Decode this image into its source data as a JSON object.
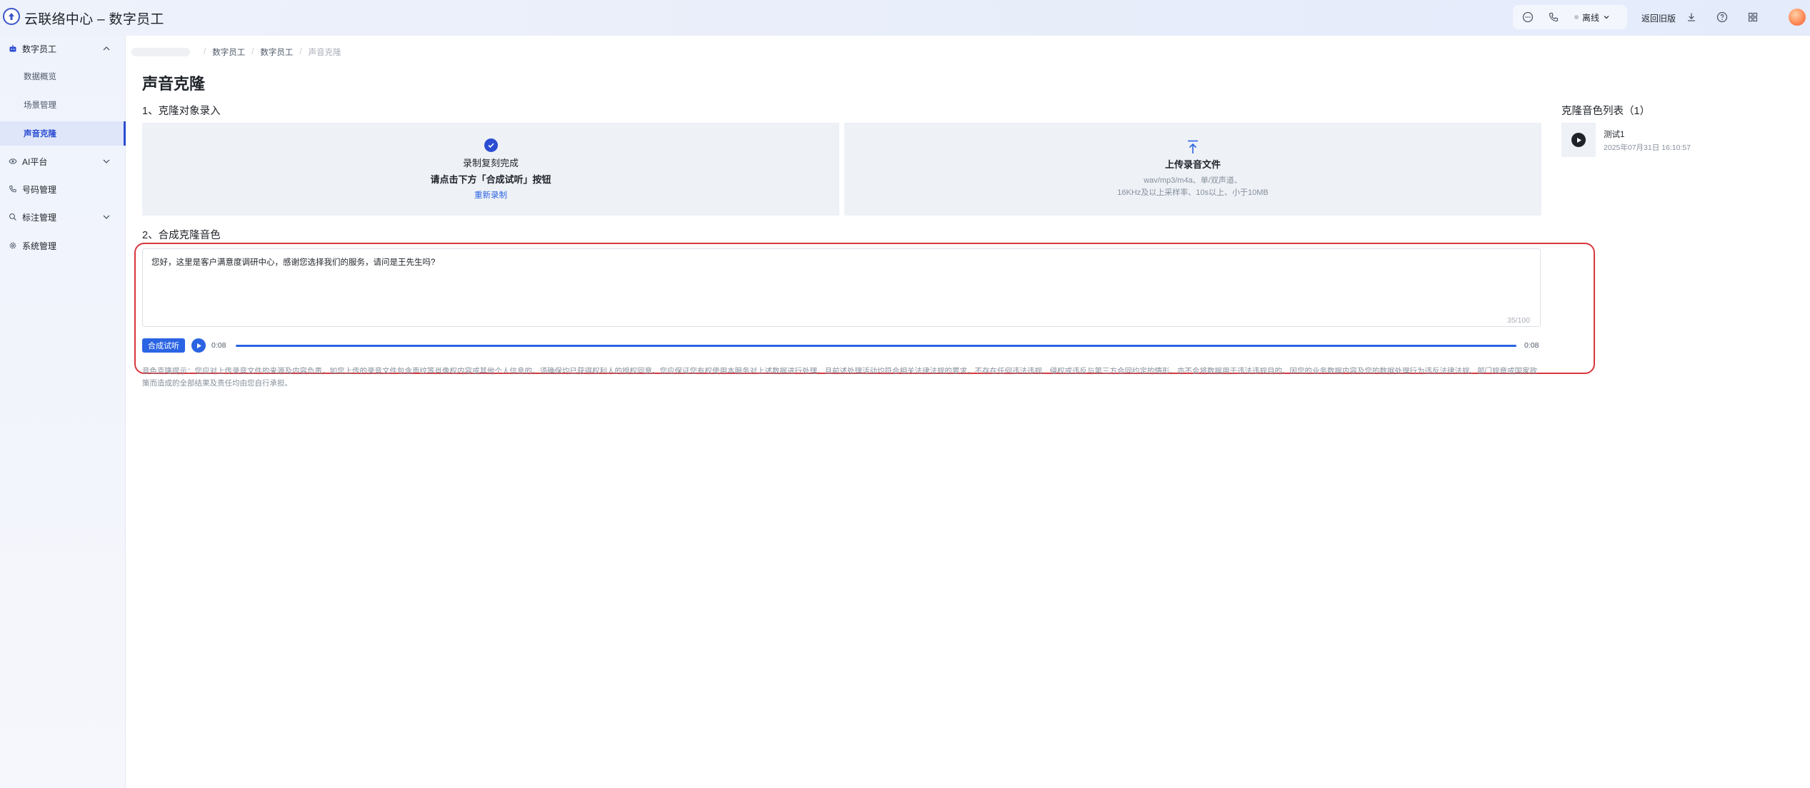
{
  "header": {
    "app_title": "云联络中心 – 数字员工",
    "status_label": "离线",
    "back_old_label": "返回旧版"
  },
  "sidebar": {
    "groups": [
      {
        "label": "数字员工",
        "icon": "robot-icon",
        "expanded": true
      },
      {
        "label": "AI平台",
        "icon": "eye-icon",
        "expanded": false
      },
      {
        "label": "号码管理",
        "icon": "phone-icon",
        "expanded": false
      },
      {
        "label": "标注管理",
        "icon": "search-icon",
        "expanded": false
      },
      {
        "label": "系统管理",
        "icon": "gear-icon",
        "expanded": false
      }
    ],
    "sub_items": [
      {
        "label": "数据概览",
        "active": false
      },
      {
        "label": "场景管理",
        "active": false
      },
      {
        "label": "声音克隆",
        "active": true
      }
    ]
  },
  "breadcrumb": {
    "items": [
      "数字员工",
      "数字员工"
    ],
    "current": "声音克隆"
  },
  "page_title": "声音克隆",
  "section1": {
    "title": "1、克隆对象录入",
    "record_card": {
      "line1": "录制复刻完成",
      "line2": "请点击下方「合成试听」按钮",
      "link": "重新录制"
    },
    "upload_card": {
      "title": "上传录音文件",
      "desc1": "wav/mp3/m4a、单/双声道、",
      "desc2": "16KHz及以上采样率、10s以上、小于10MB"
    }
  },
  "section2": {
    "title": "2、合成克隆音色",
    "text_value": "您好，这里是客户满意度调研中心，感谢您选择我们的服务，请问是王先生吗?",
    "char_count": "35/100",
    "synth_button": "合成试听",
    "time_start": "0:08",
    "time_end": "0:08",
    "progress": 1.0,
    "notice": "音色克隆提示：您应对上传录音文件的来源及内容负责，如您上传的录音文件包含声纹等肖像权内容或其他个人信息的，须确保均已获得权利人的授权同意。您应保证您有权使用本服务对上述数据进行处理，且前述处理活动均符合相关法律法规的要求，不存在任何违法违规、侵权或违反与第三方合同约定的情形，亦不会将数据用于违法违规目的。因您的业务数据内容及您的数据处理行为违反法律法规、部门规章或国家政策而造成的全部结果及责任均由您自行承担。"
  },
  "voice_list": {
    "title": "克隆音色列表（1）",
    "items": [
      {
        "name": "测试1",
        "date": "2025年07月31日 16:10:57"
      }
    ]
  },
  "colors": {
    "accent": "#2b64e3",
    "active_nav": "#2b4dd1",
    "highlight_frame": "#d8363c"
  }
}
